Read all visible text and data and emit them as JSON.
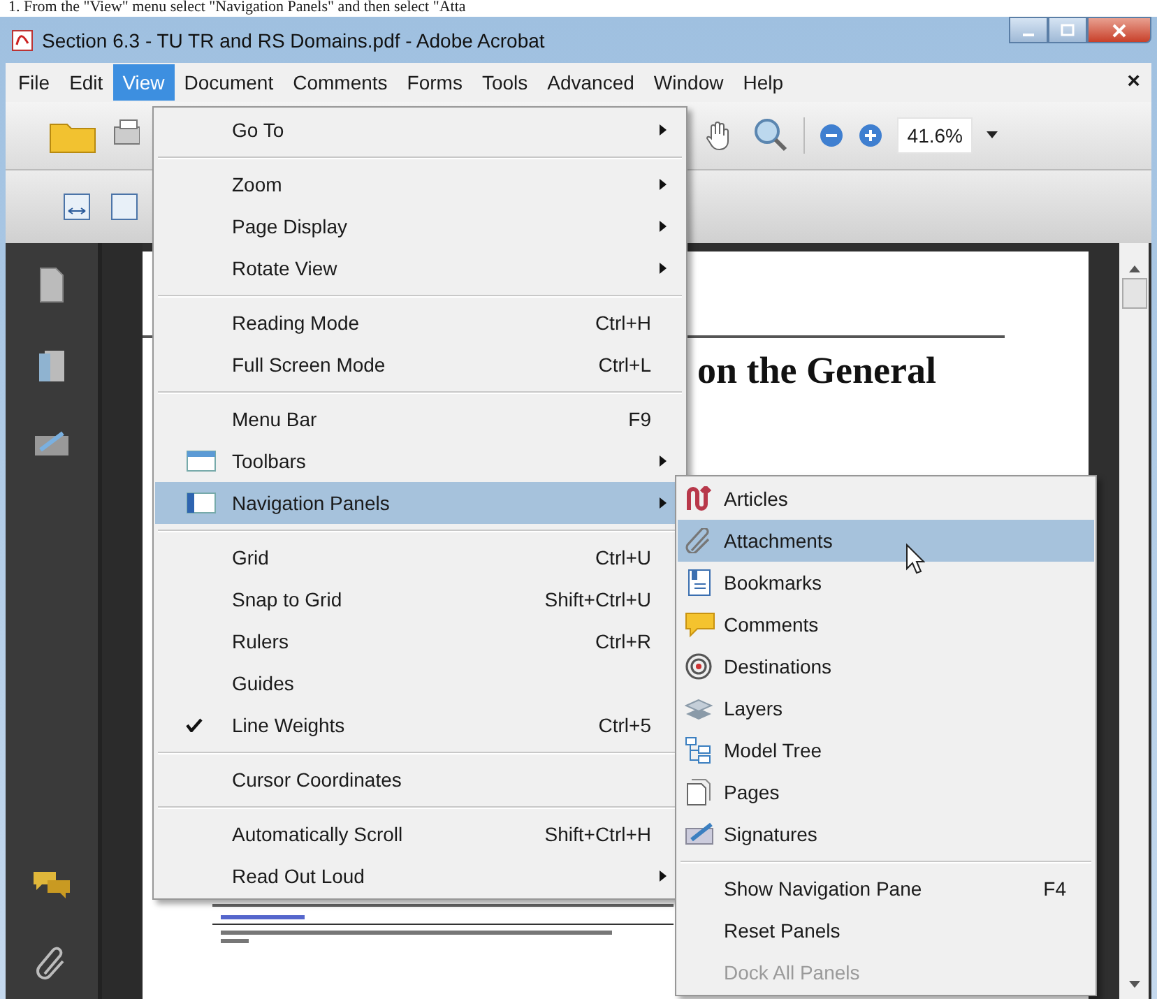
{
  "instruction": "1.   From the \"View\" menu select \"Navigation Panels\" and then select \"Atta",
  "window": {
    "title": "Section 6.3 - TU TR and RS Domains.pdf - Adobe Acrobat"
  },
  "menu_bar": {
    "items": [
      {
        "label": "File",
        "selected": false
      },
      {
        "label": "Edit",
        "selected": false
      },
      {
        "label": "View",
        "selected": true
      },
      {
        "label": "Document",
        "selected": false
      },
      {
        "label": "Comments",
        "selected": false
      },
      {
        "label": "Forms",
        "selected": false
      },
      {
        "label": "Tools",
        "selected": false
      },
      {
        "label": "Advanced",
        "selected": false
      },
      {
        "label": "Window",
        "selected": false
      },
      {
        "label": "Help",
        "selected": false
      }
    ],
    "close": "×"
  },
  "toolbar": {
    "zoom": "41.6%"
  },
  "document": {
    "heading": "on the General"
  },
  "view_menu": {
    "groups": [
      [
        {
          "label": "Go To",
          "submenu": true,
          "checked": false,
          "selected": false
        }
      ],
      [
        {
          "label": "Zoom",
          "submenu": true,
          "checked": false,
          "selected": false
        },
        {
          "label": "Page Display",
          "submenu": true,
          "checked": false,
          "selected": false
        },
        {
          "label": "Rotate View",
          "submenu": true,
          "checked": false,
          "selected": false
        }
      ],
      [
        {
          "label": "Reading Mode",
          "shortcut": "Ctrl+H",
          "submenu": false,
          "checked": false,
          "selected": false
        },
        {
          "label": "Full Screen Mode",
          "shortcut": "Ctrl+L",
          "submenu": false,
          "checked": false,
          "selected": false
        }
      ],
      [
        {
          "label": "Menu Bar",
          "shortcut": "F9",
          "submenu": false,
          "checked": false,
          "selected": false
        },
        {
          "label": "Toolbars",
          "submenu": true,
          "checked": false,
          "selected": false
        },
        {
          "label": "Navigation Panels",
          "submenu": true,
          "checked": false,
          "selected": true
        }
      ],
      [
        {
          "label": "Grid",
          "shortcut": "Ctrl+U",
          "submenu": false,
          "checked": false,
          "selected": false
        },
        {
          "label": "Snap to Grid",
          "shortcut": "Shift+Ctrl+U",
          "submenu": false,
          "checked": false,
          "selected": false
        },
        {
          "label": "Rulers",
          "shortcut": "Ctrl+R",
          "submenu": false,
          "checked": false,
          "selected": false
        },
        {
          "label": "Guides",
          "submenu": false,
          "checked": false,
          "selected": false
        },
        {
          "label": "Line Weights",
          "shortcut": "Ctrl+5",
          "submenu": false,
          "checked": true,
          "selected": false
        }
      ],
      [
        {
          "label": "Cursor Coordinates",
          "submenu": false,
          "checked": false,
          "selected": false
        }
      ],
      [
        {
          "label": "Automatically Scroll",
          "shortcut": "Shift+Ctrl+H",
          "submenu": false,
          "checked": false,
          "selected": false
        },
        {
          "label": "Read Out Loud",
          "submenu": true,
          "checked": false,
          "selected": false
        }
      ]
    ]
  },
  "navigation_panels_menu": {
    "groups": [
      [
        {
          "label": "Articles",
          "selected": false,
          "disabled": false
        },
        {
          "label": "Attachments",
          "selected": true,
          "disabled": false
        },
        {
          "label": "Bookmarks",
          "selected": false,
          "disabled": false
        },
        {
          "label": "Comments",
          "selected": false,
          "disabled": false
        },
        {
          "label": "Destinations",
          "selected": false,
          "disabled": false
        },
        {
          "label": "Layers",
          "selected": false,
          "disabled": false
        },
        {
          "label": "Model Tree",
          "selected": false,
          "disabled": false
        },
        {
          "label": "Pages",
          "selected": false,
          "disabled": false
        },
        {
          "label": "Signatures",
          "selected": false,
          "disabled": false
        }
      ],
      [
        {
          "label": "Show Navigation Pane",
          "shortcut": "F4",
          "selected": false,
          "disabled": false
        },
        {
          "label": "Reset Panels",
          "selected": false,
          "disabled": false
        },
        {
          "label": "Dock All Panels",
          "selected": false,
          "disabled": true
        }
      ]
    ]
  }
}
